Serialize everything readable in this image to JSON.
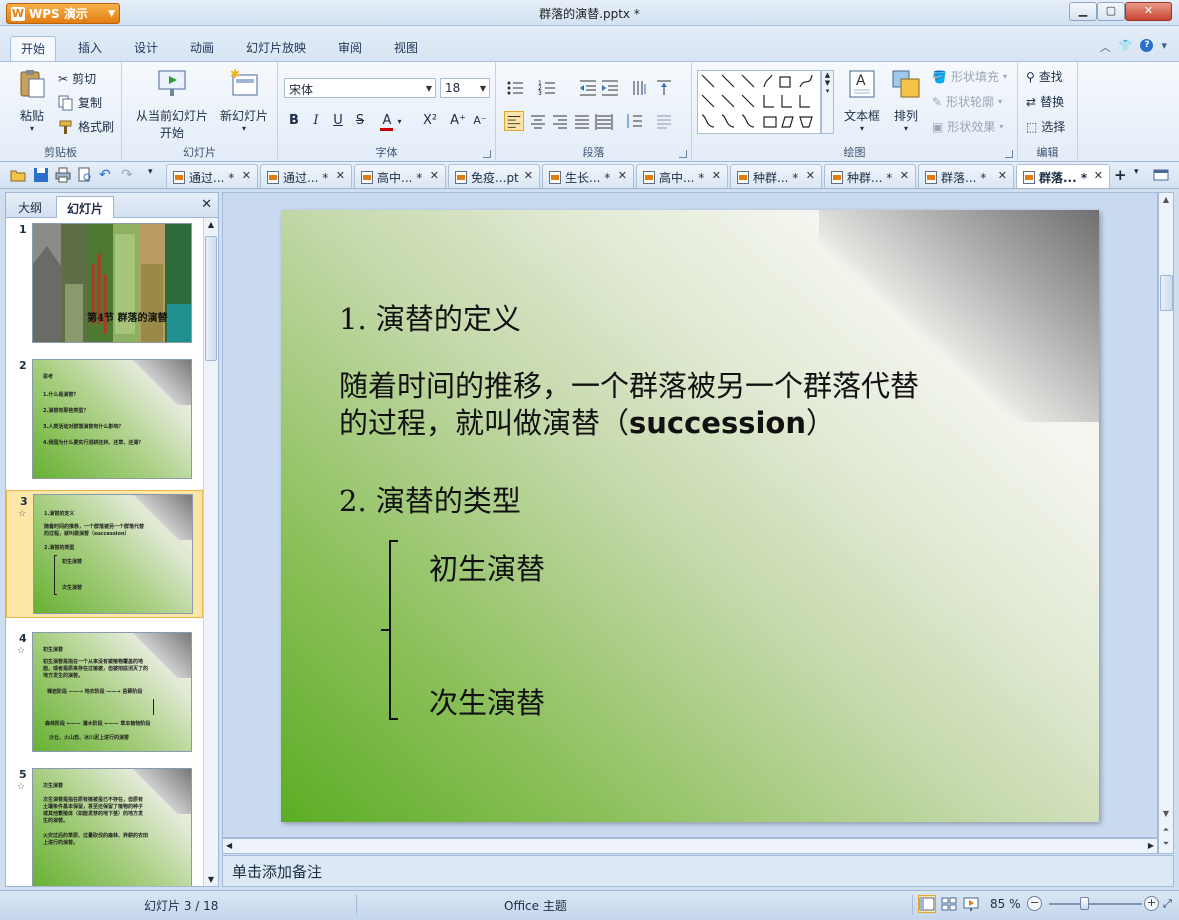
{
  "window": {
    "app_name": "WPS 演示",
    "title": "群落的演替.pptx *"
  },
  "menu": {
    "tabs": [
      "开始",
      "插入",
      "设计",
      "动画",
      "幻灯片放映",
      "审阅",
      "视图"
    ],
    "active": "开始"
  },
  "ribbon": {
    "clipboard": {
      "paste": "粘贴",
      "cut": "剪切",
      "copy": "复制",
      "format_painter": "格式刷",
      "label": "剪贴板"
    },
    "slides": {
      "from_current_line1": "从当前幻灯片",
      "from_current_line2": "开始",
      "new_slide": "新幻灯片",
      "label": "幻灯片"
    },
    "font": {
      "font_name": "宋体",
      "font_size": "18",
      "label": "字体"
    },
    "paragraph": {
      "label": "段落"
    },
    "drawing": {
      "textbox": "文本框",
      "arrange": "排列",
      "shape_fill": "形状填充",
      "shape_outline": "形状轮廓",
      "shape_effects": "形状效果",
      "label": "绘图"
    },
    "editing": {
      "find": "查找",
      "replace": "替换",
      "select": "选择",
      "label": "编辑"
    }
  },
  "doc_tabs": [
    {
      "label": "通过... *",
      "active": false
    },
    {
      "label": "通过... *",
      "active": false
    },
    {
      "label": "高中... *",
      "active": false
    },
    {
      "label": "免疫...pt",
      "active": false
    },
    {
      "label": "生长... *",
      "active": false
    },
    {
      "label": "高中... *",
      "active": false
    },
    {
      "label": "种群... *",
      "active": false
    },
    {
      "label": "种群... *",
      "active": false
    },
    {
      "label": "群落... *",
      "active": false
    },
    {
      "label": "群落... *",
      "active": true
    }
  ],
  "left_panel": {
    "tab_outline": "大纲",
    "tab_slides": "幻灯片",
    "thumbnails": [
      {
        "num": "1",
        "title": "第4节 群落的演替"
      },
      {
        "num": "2",
        "lines": [
          "思考",
          "1.什么是演替？",
          "2.演替有那些类型？",
          "3.人类活动对群落演替有什么影响？",
          "4.我国为什么要实行退耕还林、还草、还湖？"
        ]
      },
      {
        "num": "3",
        "lines": [
          "1.演替的定义",
          "随着时间的推移，一个群落被另一个群落代替",
          "的过程，就叫做演替（succession）",
          "2.演替的类型",
          "初生演替",
          "次生演替"
        ]
      },
      {
        "num": "4",
        "lines": [
          "初生演替",
          "初生演替是指在一个从来没有被植物覆盖的地",
          "面，或者是原来存在过植被，但被彻底消灭了的",
          "地方发生的演替。",
          "裸岩阶段 ——→ 地衣阶段 ——→ 苔藓阶段",
          "森林阶段 ←—— 灌木阶段 ←—— 草本植物阶段",
          "沙丘、火山岩、冰川泥上进行的演替"
        ]
      },
      {
        "num": "5",
        "lines": [
          "次生演替",
          "次生演替是指在原有植被虽已不存在，但原有",
          "土壤条件基本保留，甚至还保留了植物的种子",
          "或其他繁殖体（如能发芽的地下茎）的地方发",
          "生的演替。",
          "火灾过后的草原、过量砍伐的森林、弃耕的农田",
          "上进行的演替。"
        ]
      }
    ]
  },
  "slide": {
    "heading1": "1. 演替的定义",
    "body_line1": "随着时间的推移，一个群落被另一个群落代替",
    "body_line2_pre": "的过程，就叫做演替（",
    "body_line2_en": "succession",
    "body_line2_post": "）",
    "heading2": "2. 演替的类型",
    "type1": "初生演替",
    "type2": "次生演替"
  },
  "notes_placeholder": "单击添加备注",
  "status": {
    "slide_info": "幻灯片 3 / 18",
    "theme": "Office 主题",
    "zoom": "85 %"
  }
}
